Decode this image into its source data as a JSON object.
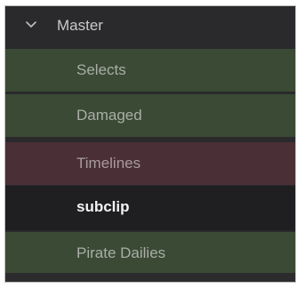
{
  "bin_list": {
    "master": {
      "label": "Master",
      "expanded": true,
      "icon": "chevron-down-icon"
    },
    "items": [
      {
        "label": "Selects",
        "color": "#3a4a35"
      },
      {
        "label": "Damaged",
        "color": "#3a4a35"
      },
      {
        "label": "Timelines",
        "color": "#4a2f36"
      },
      {
        "label": "subclip",
        "color": "#1f1f22",
        "selected": true
      },
      {
        "label": "Pirate Dailies",
        "color": "#3a4a35"
      }
    ]
  }
}
